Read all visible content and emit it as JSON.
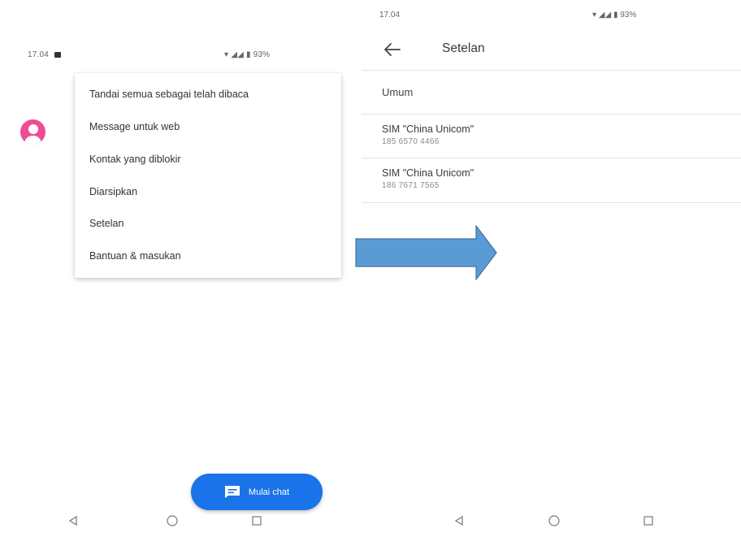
{
  "left_screen": {
    "status_bar": {
      "time": "17.04",
      "indicators": "▾ ◢◢ ▮ 93%"
    },
    "overflow_menu": {
      "items": [
        "Tandai semua sebagai telah dibaca",
        "Message untuk web",
        "Kontak yang diblokir",
        "Diarsipkan",
        "Setelan",
        "Bantuan & masukan"
      ]
    },
    "fab": {
      "label": "Mulai chat",
      "icon": "chat-icon"
    },
    "avatar_color": "#ee4c94"
  },
  "right_screen": {
    "status_bar": {
      "time": "17.04",
      "indicators": "▾ ◢◢ ▮ 93%"
    },
    "header": {
      "title": "Setelan"
    },
    "list": {
      "general": "Umum",
      "sims": [
        {
          "name": "SIM \"China Unicom\"",
          "number": "185 6570 4466"
        },
        {
          "name": "SIM \"China Unicom\"",
          "number": "186 7671 7565"
        }
      ]
    }
  },
  "colors": {
    "accent": "#1a73e8",
    "arrow_fill": "#5b9bd5",
    "arrow_stroke": "#41719c"
  }
}
